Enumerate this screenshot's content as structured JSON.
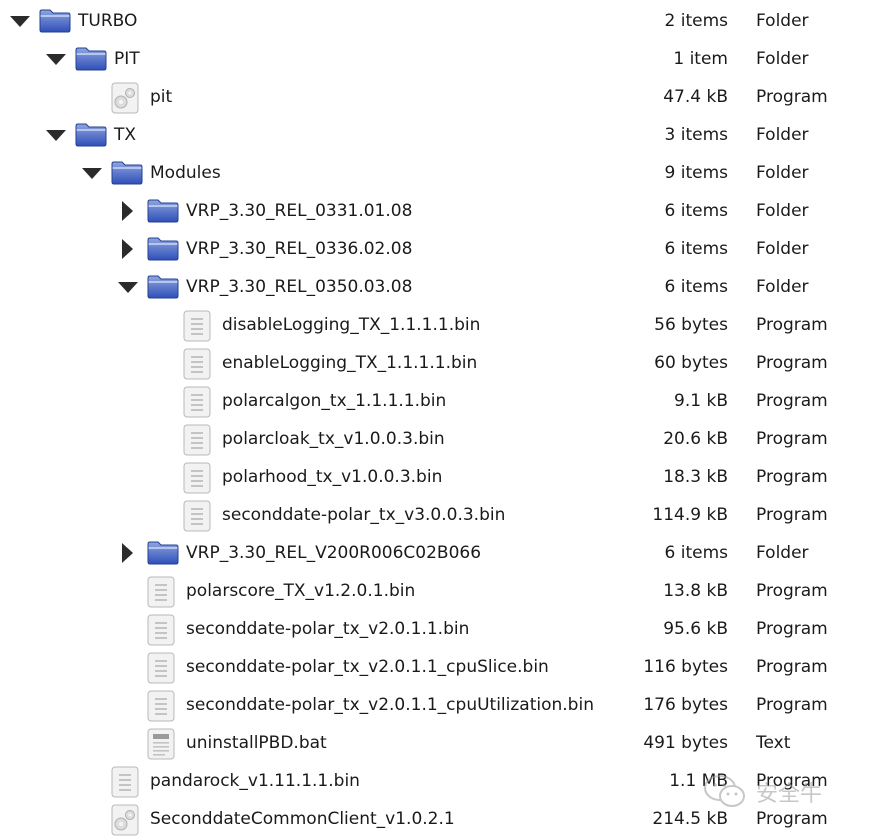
{
  "rows": [
    {
      "depth": 0,
      "expander": "open",
      "icon": "folder-icon",
      "name": "TURBO",
      "size": "2 items",
      "kind": "Folder"
    },
    {
      "depth": 1,
      "expander": "open",
      "icon": "folder-icon",
      "name": "PIT",
      "size": "1 item",
      "kind": "Folder"
    },
    {
      "depth": 2,
      "expander": "none",
      "icon": "executable-icon",
      "name": "pit",
      "size": "47.4 kB",
      "kind": "Program"
    },
    {
      "depth": 1,
      "expander": "open",
      "icon": "folder-icon",
      "name": "TX",
      "size": "3 items",
      "kind": "Folder"
    },
    {
      "depth": 2,
      "expander": "open",
      "icon": "folder-icon",
      "name": "Modules",
      "size": "9 items",
      "kind": "Folder"
    },
    {
      "depth": 3,
      "expander": "closed",
      "icon": "folder-icon",
      "name": "VRP_3.30_REL_0331.01.08",
      "size": "6 items",
      "kind": "Folder"
    },
    {
      "depth": 3,
      "expander": "closed",
      "icon": "folder-icon",
      "name": "VRP_3.30_REL_0336.02.08",
      "size": "6 items",
      "kind": "Folder"
    },
    {
      "depth": 3,
      "expander": "open",
      "icon": "folder-icon",
      "name": "VRP_3.30_REL_0350.03.08",
      "size": "6 items",
      "kind": "Folder"
    },
    {
      "depth": 4,
      "expander": "none",
      "icon": "binary-file-icon",
      "name": "disableLogging_TX_1.1.1.1.bin",
      "size": "56 bytes",
      "kind": "Program"
    },
    {
      "depth": 4,
      "expander": "none",
      "icon": "binary-file-icon",
      "name": "enableLogging_TX_1.1.1.1.bin",
      "size": "60 bytes",
      "kind": "Program"
    },
    {
      "depth": 4,
      "expander": "none",
      "icon": "binary-file-icon",
      "name": "polarcalgon_tx_1.1.1.1.bin",
      "size": "9.1 kB",
      "kind": "Program"
    },
    {
      "depth": 4,
      "expander": "none",
      "icon": "binary-file-icon",
      "name": "polarcloak_tx_v1.0.0.3.bin",
      "size": "20.6 kB",
      "kind": "Program"
    },
    {
      "depth": 4,
      "expander": "none",
      "icon": "binary-file-icon",
      "name": "polarhood_tx_v1.0.0.3.bin",
      "size": "18.3 kB",
      "kind": "Program"
    },
    {
      "depth": 4,
      "expander": "none",
      "icon": "binary-file-icon",
      "name": "seconddate-polar_tx_v3.0.0.3.bin",
      "size": "114.9 kB",
      "kind": "Program"
    },
    {
      "depth": 3,
      "expander": "closed",
      "icon": "folder-icon",
      "name": "VRP_3.30_REL_V200R006C02B066",
      "size": "6 items",
      "kind": "Folder"
    },
    {
      "depth": 3,
      "expander": "none",
      "icon": "binary-file-icon",
      "name": "polarscore_TX_v1.2.0.1.bin",
      "size": "13.8 kB",
      "kind": "Program"
    },
    {
      "depth": 3,
      "expander": "none",
      "icon": "binary-file-icon",
      "name": "seconddate-polar_tx_v2.0.1.1.bin",
      "size": "95.6 kB",
      "kind": "Program"
    },
    {
      "depth": 3,
      "expander": "none",
      "icon": "binary-file-icon",
      "name": "seconddate-polar_tx_v2.0.1.1_cpuSlice.bin",
      "size": "116 bytes",
      "kind": "Program"
    },
    {
      "depth": 3,
      "expander": "none",
      "icon": "binary-file-icon",
      "name": "seconddate-polar_tx_v2.0.1.1_cpuUtilization.bin",
      "size": "176 bytes",
      "kind": "Program"
    },
    {
      "depth": 3,
      "expander": "none",
      "icon": "text-file-icon",
      "name": "uninstallPBD.bat",
      "size": "491 bytes",
      "kind": "Text"
    },
    {
      "depth": 2,
      "expander": "none",
      "icon": "binary-file-icon",
      "name": "pandarock_v1.11.1.1.bin",
      "size": "1.1 MB",
      "kind": "Program"
    },
    {
      "depth": 2,
      "expander": "none",
      "icon": "executable-icon",
      "name": "SeconddateCommonClient_v1.0.2.1",
      "size": "214.5 kB",
      "kind": "Program"
    }
  ],
  "watermark": {
    "text": "安全牛",
    "icon": "wechat-icon"
  },
  "colors": {
    "folder_top": "#8fa6e0",
    "folder_bottom": "#2f4fb8",
    "file_bg": "#f2f2f2",
    "file_border": "#b8b8b8"
  }
}
